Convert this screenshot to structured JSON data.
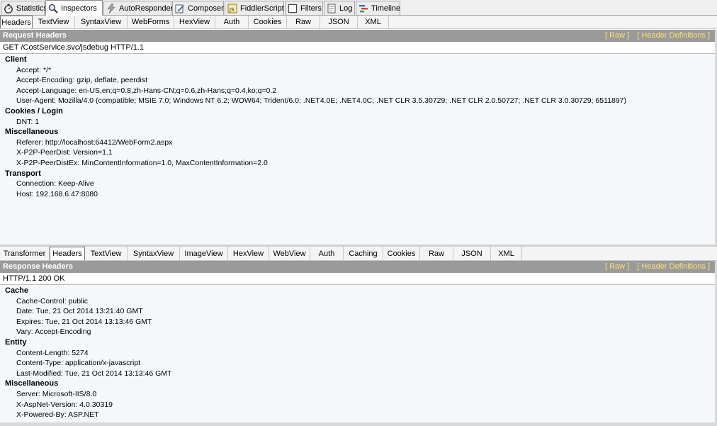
{
  "main_tabs": [
    {
      "label": "Statistics",
      "icon": "stopwatch-icon"
    },
    {
      "label": "Inspectors",
      "icon": "magnifier-icon"
    },
    {
      "label": "AutoResponder",
      "icon": "lightning-icon"
    },
    {
      "label": "Composer",
      "icon": "pencil-icon"
    },
    {
      "label": "FiddlerScript",
      "icon": "script-icon"
    },
    {
      "label": "Filters",
      "icon": "checkbox-icon"
    },
    {
      "label": "Log",
      "icon": "log-icon"
    },
    {
      "label": "Timeline",
      "icon": "timeline-icon"
    }
  ],
  "request_tabs": [
    "Headers",
    "TextView",
    "SyntaxView",
    "WebForms",
    "HexView",
    "Auth",
    "Cookies",
    "Raw",
    "JSON",
    "XML"
  ],
  "request": {
    "title": "Request Headers",
    "raw_link": "[ Raw ]",
    "defs_link": "[ Header Definitions ]",
    "status_line": "GET /CostService.svc/jsdebug HTTP/1.1",
    "groups": [
      {
        "name": "Client",
        "items": [
          "Accept: */*",
          "Accept-Encoding: gzip, deflate, peerdist",
          "Accept-Language: en-US,en;q=0.8,zh-Hans-CN;q=0.6,zh-Hans;q=0.4,ko;q=0.2",
          "User-Agent: Mozilla/4.0 (compatible; MSIE 7.0; Windows NT 6.2; WOW64; Trident/6.0; .NET4.0E; .NET4.0C; .NET CLR 3.5.30729; .NET CLR 2.0.50727; .NET CLR 3.0.30729; 6511897)"
        ]
      },
      {
        "name": "Cookies / Login",
        "items": [
          "DNT: 1"
        ]
      },
      {
        "name": "Miscellaneous",
        "items": [
          "Referer: http://localhost:64412/WebForm2.aspx",
          "X-P2P-PeerDist: Version=1.1",
          "X-P2P-PeerDistEx: MinContentInformation=1.0, MaxContentInformation=2.0"
        ]
      },
      {
        "name": "Transport",
        "items": [
          "Connection: Keep-Alive",
          "Host: 192.168.6.47:8080"
        ]
      }
    ]
  },
  "response_tabs": [
    "Transformer",
    "Headers",
    "TextView",
    "SyntaxView",
    "ImageView",
    "HexView",
    "WebView",
    "Auth",
    "Caching",
    "Cookies",
    "Raw",
    "JSON",
    "XML"
  ],
  "response": {
    "title": "Response Headers",
    "raw_link": "[ Raw ]",
    "defs_link": "[ Header Definitions ]",
    "status_line": "HTTP/1.1 200 OK",
    "groups": [
      {
        "name": "Cache",
        "items": [
          "Cache-Control: public",
          "Date: Tue, 21 Oct 2014 13:21:40 GMT",
          "Expires: Tue, 21 Oct 2014 13:13:46 GMT",
          "Vary: Accept-Encoding"
        ]
      },
      {
        "name": "Entity",
        "items": [
          "Content-Length: 5274",
          "Content-Type: application/x-javascript",
          "Last-Modified: Tue, 21 Oct 2014 13:13:46 GMT"
        ]
      },
      {
        "name": "Miscellaneous",
        "items": [
          "Server: Microsoft-IIS/8.0",
          "X-AspNet-Version: 4.0.30319",
          "X-Powered-By: ASP.NET"
        ]
      }
    ]
  },
  "colors": {
    "pane_title_bg": "#9a9a9a",
    "link_yellow": "#ffe06b",
    "pane_bg": "#f4f8fb"
  }
}
